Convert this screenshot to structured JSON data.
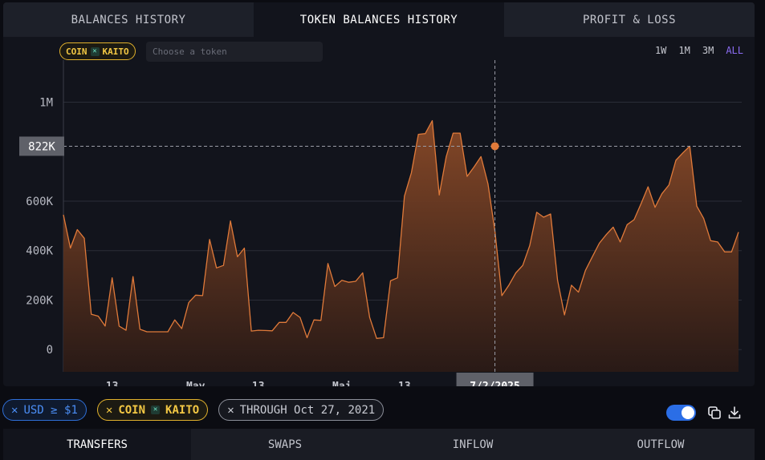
{
  "top_tabs": [
    {
      "label": "BALANCES HISTORY"
    },
    {
      "label": "TOKEN BALANCES HISTORY"
    },
    {
      "label": "PROFIT & LOSS"
    }
  ],
  "active_top_tab": 1,
  "token_filter": {
    "label": "COIN",
    "token": "KAITO",
    "placeholder": "Choose a token"
  },
  "ranges": [
    {
      "label": "1W"
    },
    {
      "label": "1M"
    },
    {
      "label": "3M"
    },
    {
      "label": "ALL"
    }
  ],
  "active_range": 3,
  "colors": {
    "line": "#e07a3a",
    "accent_purple": "#8b6cf2",
    "coin_yellow": "#f2c744",
    "usd_blue": "#4b8ef5"
  },
  "chart_data": {
    "type": "area",
    "y_ticks": [
      {
        "label": "1M",
        "value": 1000000
      },
      {
        "label": "600K",
        "value": 600000
      },
      {
        "label": "400K",
        "value": 400000
      },
      {
        "label": "200K",
        "value": 200000
      },
      {
        "label": "0",
        "value": 0
      }
    ],
    "ylim": [
      -90000,
      1170000
    ],
    "x_ticks": [
      {
        "label": "13",
        "index": 7
      },
      {
        "label": "May",
        "index": 19
      },
      {
        "label": "13",
        "index": 28
      },
      {
        "label": "Maj",
        "index": 40
      },
      {
        "label": "13",
        "index": 49
      }
    ],
    "crosshair": {
      "index": 62,
      "value_label": "822K",
      "date_label": "7/2/2025",
      "value": 822000
    },
    "values": [
      545000,
      410000,
      485000,
      450000,
      143000,
      135000,
      95000,
      290000,
      95000,
      78000,
      295000,
      82000,
      72000,
      72000,
      72000,
      72000,
      120000,
      85000,
      190000,
      220000,
      218000,
      445000,
      330000,
      340000,
      520000,
      375000,
      410000,
      75000,
      78000,
      77000,
      76000,
      110000,
      110000,
      150000,
      130000,
      48000,
      120000,
      118000,
      348000,
      255000,
      280000,
      272000,
      276000,
      310000,
      130000,
      45000,
      48000,
      278000,
      290000,
      620000,
      715000,
      870000,
      873000,
      925000,
      625000,
      780000,
      875000,
      875000,
      700000,
      738000,
      780000,
      670000,
      480000,
      218000,
      260000,
      310000,
      340000,
      420000,
      555000,
      535000,
      548000,
      280000,
      140000,
      260000,
      232000,
      320000,
      375000,
      430000,
      465000,
      495000,
      435000,
      505000,
      525000,
      590000,
      658000,
      575000,
      630000,
      665000,
      765000,
      795000,
      822000,
      580000,
      530000,
      440000,
      435000,
      395000,
      395000,
      475000
    ],
    "x_labels_note": ""
  },
  "filters": [
    {
      "label": "USD ≥ $1",
      "kind": "usd"
    },
    {
      "label": "COIN",
      "token": "KAITO",
      "kind": "coin"
    },
    {
      "label": "THROUGH Oct 27, 2021",
      "kind": "through"
    }
  ],
  "bottom_tabs": [
    {
      "label": "TRANSFERS"
    },
    {
      "label": "SWAPS"
    },
    {
      "label": "INFLOW"
    },
    {
      "label": "OUTFLOW"
    }
  ],
  "active_bottom_tab": 0
}
